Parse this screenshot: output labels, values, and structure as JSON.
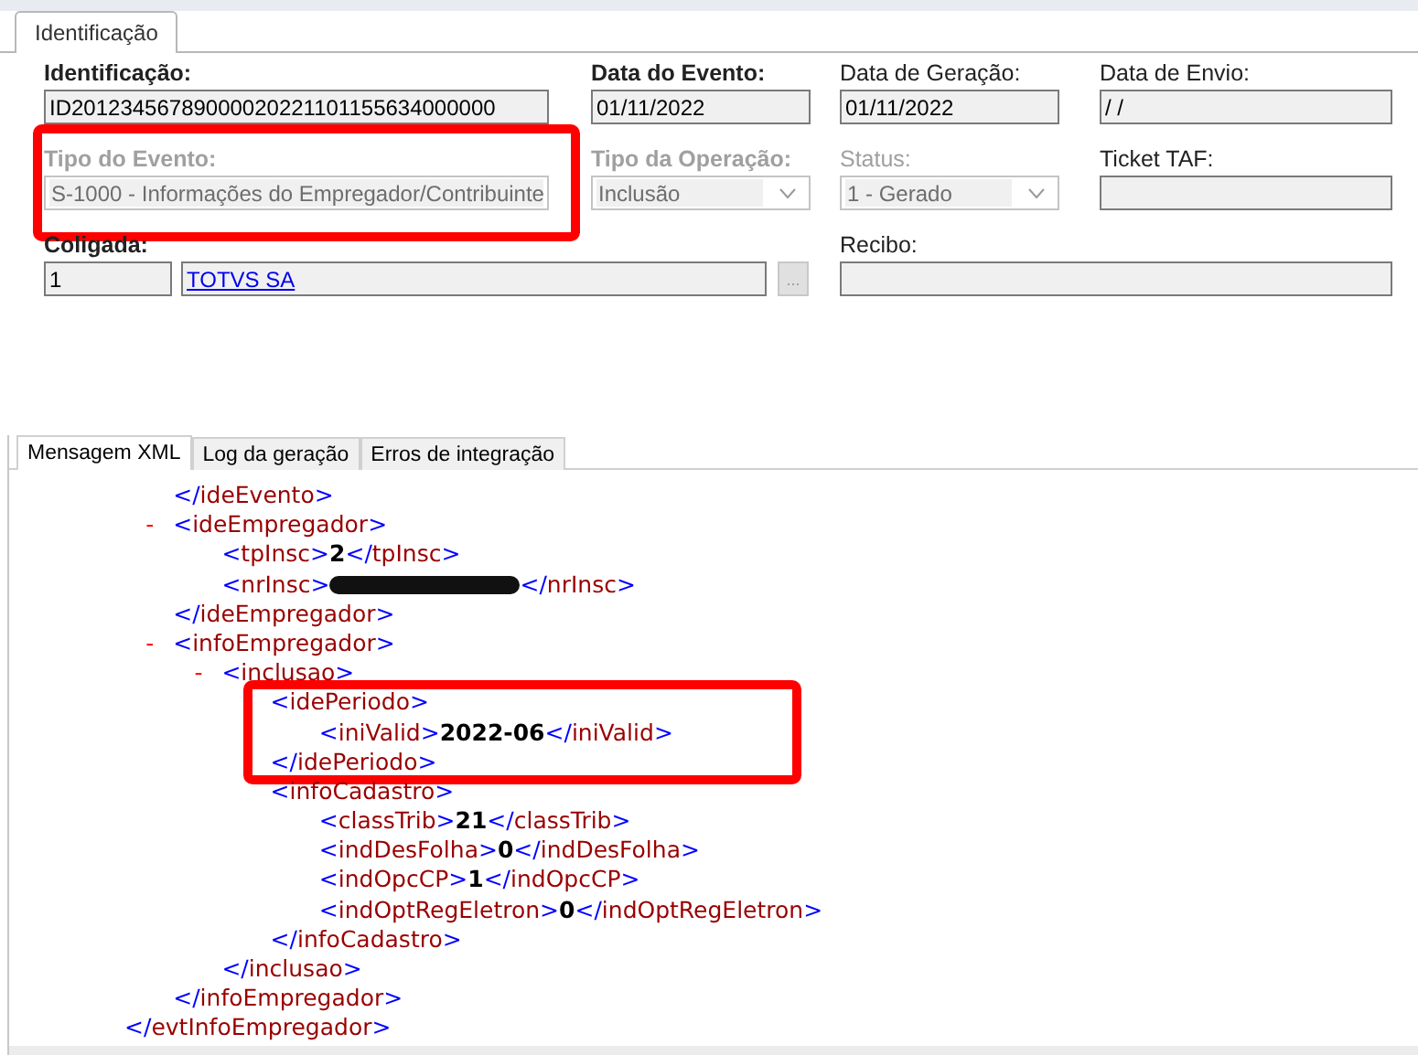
{
  "form_tabs": [
    {
      "label": "Identificação",
      "selected": true
    }
  ],
  "form_rows": [
    [
      {
        "kind": "text",
        "label": "Identificação:",
        "value": "ID20123456789000020221101155634000000",
        "required": true,
        "disabled": false,
        "highlighted": false
      },
      {
        "kind": "text",
        "label": "Data do Evento:",
        "value": "01/11/2022",
        "required": true,
        "disabled": false,
        "highlighted": false
      },
      {
        "kind": "text",
        "label": "Data de Geração:",
        "value": "01/11/2022",
        "required": false,
        "disabled": false,
        "highlighted": false
      },
      {
        "kind": "text",
        "label": "Data de Envio:",
        "value": " / /",
        "required": false,
        "disabled": false,
        "highlighted": false
      }
    ],
    [
      {
        "kind": "select",
        "label": "Tipo do Evento:",
        "value": "S-1000 - Informações do Empregador/Contribuinte",
        "required": true,
        "disabled": true,
        "highlighted": true
      },
      {
        "kind": "select",
        "label": "Tipo da Operação:",
        "value": "Inclusão",
        "required": true,
        "disabled": true,
        "highlighted": false
      },
      {
        "kind": "select",
        "label": "Status:",
        "value": "1 - Gerado",
        "required": false,
        "disabled": true,
        "highlighted": false
      },
      {
        "kind": "text",
        "label": "Ticket TAF:",
        "required": false,
        "disabled": false,
        "highlighted": false
      }
    ],
    [
      {
        "kind": "lookup",
        "label": "Coligada:",
        "code": "1",
        "value": "TOTVS SA",
        "button": "...",
        "required": true,
        "disabled": false,
        "highlighted": false
      },
      {
        "kind": "wide",
        "label": "Recibo:",
        "required": false,
        "disabled": false,
        "highlighted": false
      }
    ]
  ],
  "message_tabs": [
    {
      "label": "Mensagem XML",
      "selected": true
    },
    {
      "label": "Log da geração",
      "selected": false
    },
    {
      "label": "Erros de integração",
      "selected": false
    }
  ],
  "xml": {
    "close": "</evtInfoEmpregador>",
    "children": [
      {
        "close": "</ideEvento>"
      },
      {
        "open": "<ideEmpregador>",
        "toggle": "-",
        "expanded": true,
        "close": "</ideEmpregador>",
        "children": [
          {
            "open": "<tpInsc>",
            "value": "2",
            "close": "</tpInsc>"
          },
          {
            "open": "<nrInsc>",
            "redacted": true,
            "close": "</nrInsc>"
          }
        ]
      },
      {
        "open": "<infoEmpregador>",
        "toggle": "-",
        "expanded": true,
        "close": "</infoEmpregador>",
        "children": [
          {
            "open": "<inclusao>",
            "toggle": "-",
            "expanded": true,
            "close": "</inclusao>",
            "children": [
              {
                "open": "<idePeriodo>",
                "highlighted": true,
                "close": "</idePeriodo>",
                "children": [
                  {
                    "open": "<iniValid>",
                    "value": "2022-06",
                    "close": "</iniValid>"
                  }
                ]
              },
              {
                "open": "<infoCadastro>",
                "close": "</infoCadastro>",
                "children": [
                  {
                    "open": "<classTrib>",
                    "value": "21",
                    "close": "</classTrib>"
                  },
                  {
                    "open": "<indDesFolha>",
                    "value": "0",
                    "close": "</indDesFolha>"
                  },
                  {
                    "open": "<indOpcCP>",
                    "value": "1",
                    "close": "</indOpcCP>"
                  },
                  {
                    "open": "<indOptRegEletron>",
                    "value": "0",
                    "close": "</indOptRegEletron>"
                  }
                ]
              }
            ]
          }
        ]
      }
    ]
  }
}
